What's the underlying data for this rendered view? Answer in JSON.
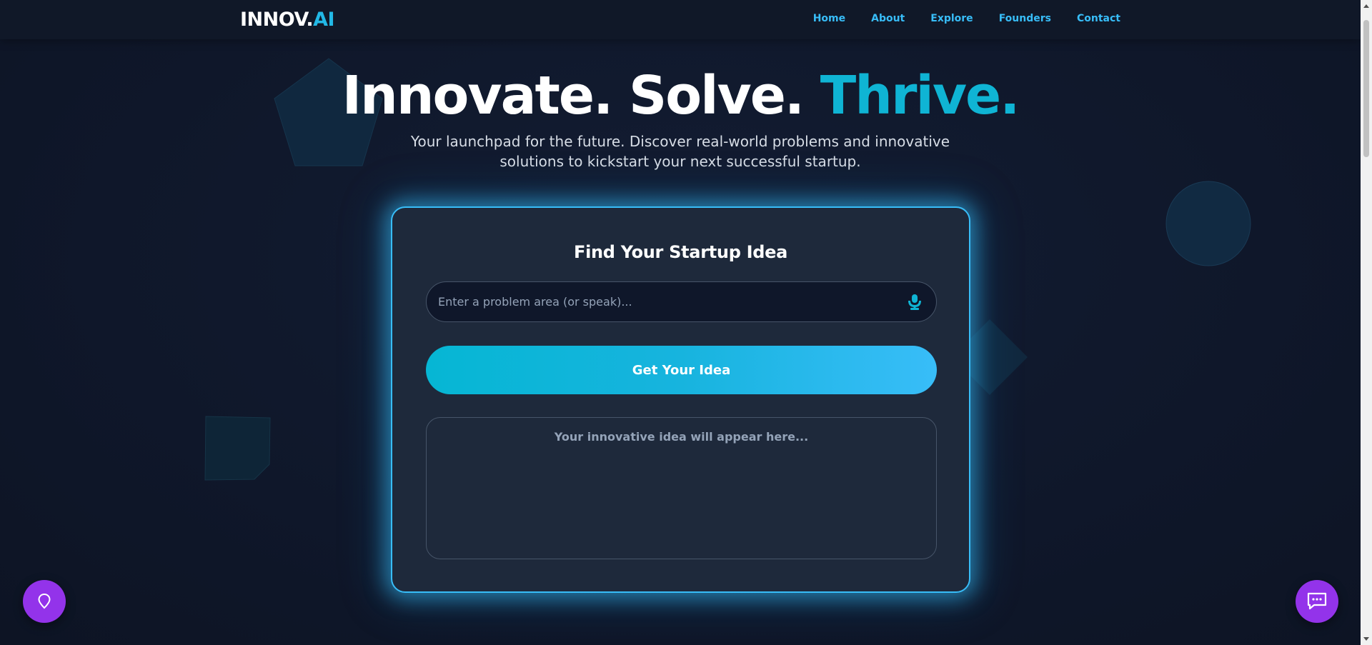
{
  "nav": {
    "logo_main": "INNOV.",
    "logo_accent": "AI",
    "links": [
      "Home",
      "About",
      "Explore",
      "Founders",
      "Contact"
    ]
  },
  "hero": {
    "title_main": "Innovate. Solve. ",
    "title_accent": "Thrive.",
    "subtitle": "Your launchpad for the future. Discover real-world problems and innovative solutions to kickstart your next successful startup."
  },
  "card": {
    "title": "Find Your Startup Idea",
    "search_placeholder": "Enter a problem area (or speak)...",
    "search_value": "",
    "mic_icon": "microphone-icon",
    "button_label": "Get Your Idea",
    "result_placeholder": "Your innovative idea will appear here..."
  },
  "floating": {
    "left_icon": "location-pin-icon",
    "right_icon": "chat-icon"
  },
  "colors": {
    "background": "#0f172a",
    "accent": "#0fb4d4",
    "nav_link": "#38bdf8",
    "fab": "#9333ea",
    "card": "#1e293b"
  }
}
